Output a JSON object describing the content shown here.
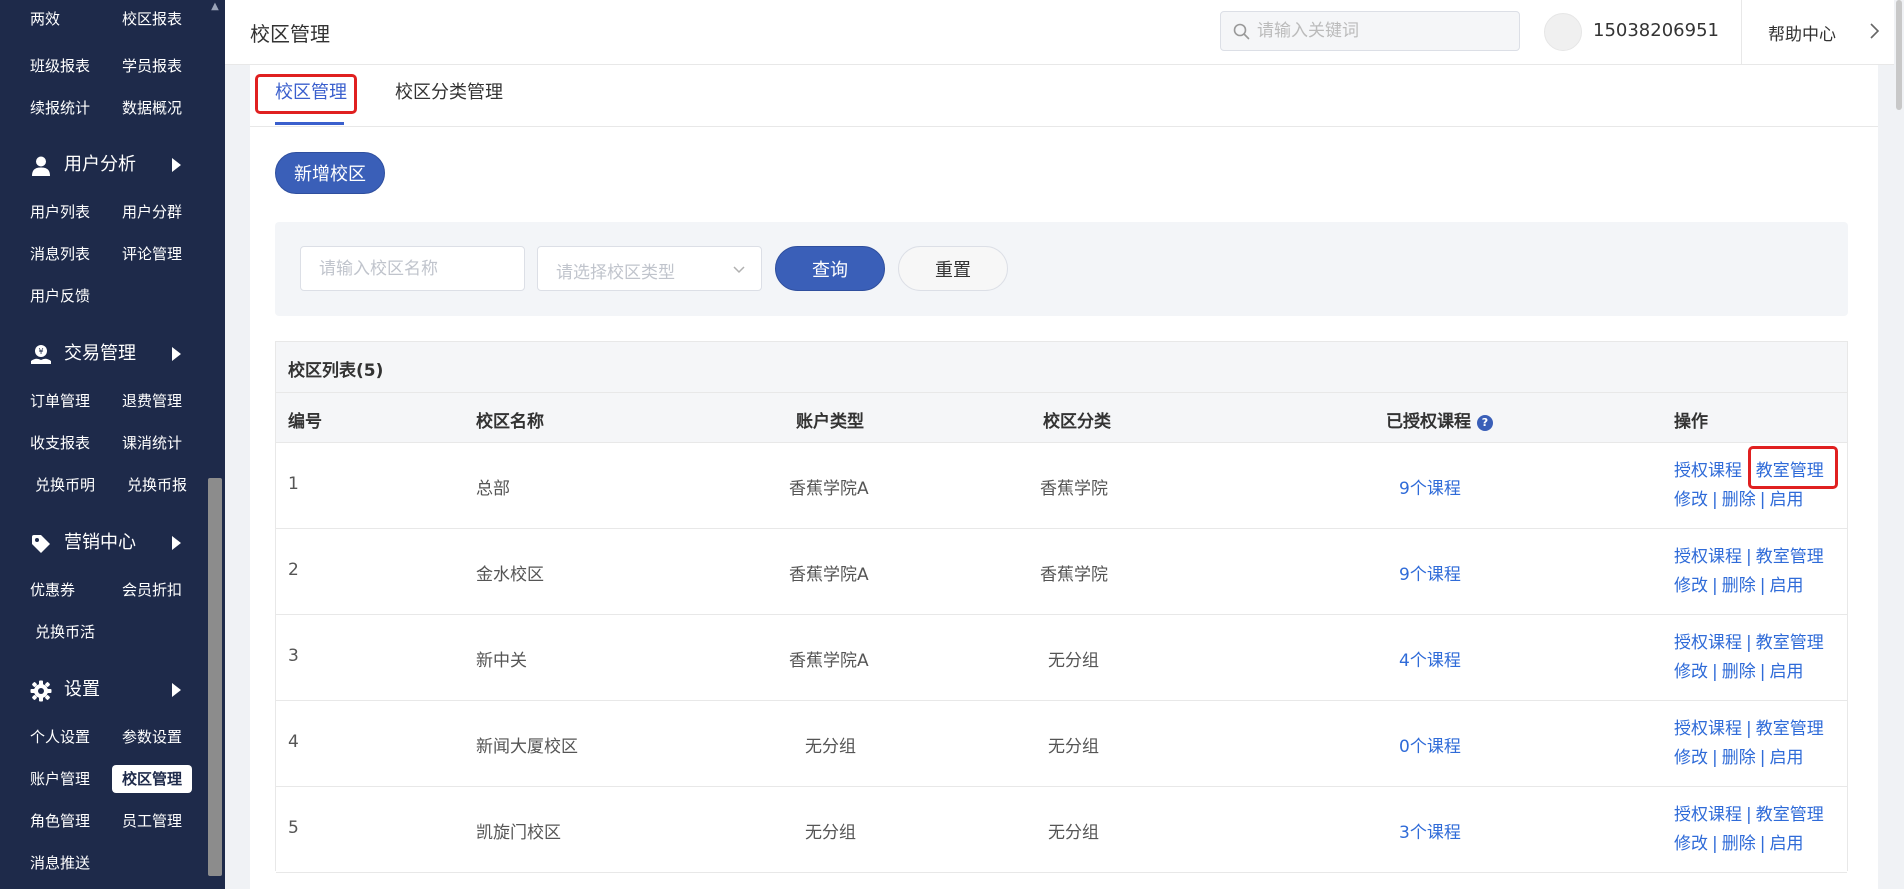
{
  "sidebar": {
    "rows_top": [
      [
        "两效",
        "校区报表"
      ],
      [
        "班级报表",
        "学员报表"
      ],
      [
        "续报统计",
        "数据概况"
      ]
    ],
    "groups": {
      "user": {
        "label": "用户分析",
        "icon": "user-icon",
        "rows": [
          [
            "用户列表",
            "用户分群"
          ],
          [
            "消息列表",
            "评论管理"
          ],
          [
            "用户反馈"
          ]
        ]
      },
      "trade": {
        "label": "交易管理",
        "icon": "money-hand-icon",
        "rows": [
          [
            "订单管理",
            "退费管理"
          ],
          [
            "收支报表",
            "课消统计"
          ],
          [
            "兑换币明",
            "兑换币报"
          ]
        ]
      },
      "marketing": {
        "label": "营销中心",
        "icon": "tag-icon",
        "rows": [
          [
            "优惠券",
            "会员折扣"
          ],
          [
            "兑换币活"
          ]
        ]
      },
      "settings": {
        "label": "设置",
        "icon": "gear-icon",
        "rows": [
          [
            "个人设置",
            "参数设置"
          ],
          [
            "账户管理",
            "校区管理"
          ],
          [
            "角色管理",
            "员工管理"
          ],
          [
            "消息推送"
          ]
        ]
      }
    },
    "active_item": "校区管理"
  },
  "header": {
    "title": "校区管理",
    "search_placeholder": "请输入关键词",
    "phone": "15038206951",
    "help": "帮助中心"
  },
  "tabs": [
    {
      "label": "校区管理",
      "active": true
    },
    {
      "label": "校区分类管理",
      "active": false
    }
  ],
  "toolbar": {
    "add_label": "新增校区"
  },
  "filter": {
    "name_placeholder": "请输入校区名称",
    "type_placeholder": "请选择校区类型",
    "query_label": "查询",
    "reset_label": "重置"
  },
  "table": {
    "title": "校区列表(5)",
    "columns": [
      "编号",
      "校区名称",
      "账户类型",
      "校区分类",
      "已授权课程",
      "操作"
    ],
    "rows": [
      {
        "id": "1",
        "name": "总部",
        "account_type": "香蕉学院A",
        "category": "香蕉学院",
        "courses": "9个课程"
      },
      {
        "id": "2",
        "name": "金水校区",
        "account_type": "香蕉学院A",
        "category": "香蕉学院",
        "courses": "9个课程"
      },
      {
        "id": "3",
        "name": "新中关",
        "account_type": "香蕉学院A",
        "category": "无分组",
        "courses": "4个课程"
      },
      {
        "id": "4",
        "name": "新闻大厦校区",
        "account_type": "无分组",
        "category": "无分组",
        "courses": "0个课程"
      },
      {
        "id": "5",
        "name": "凯旋门校区",
        "account_type": "无分组",
        "category": "无分组",
        "courses": "3个课程"
      }
    ],
    "ops": {
      "auth": "授权课程",
      "classroom": "教室管理",
      "edit": "修改",
      "delete": "删除",
      "enable": "启用",
      "sep": "|"
    }
  },
  "colors": {
    "sidebar_bg": "#1e2a4a",
    "primary": "#3a5fb8",
    "link": "#2f6bd8",
    "highlight": "#e02020"
  }
}
